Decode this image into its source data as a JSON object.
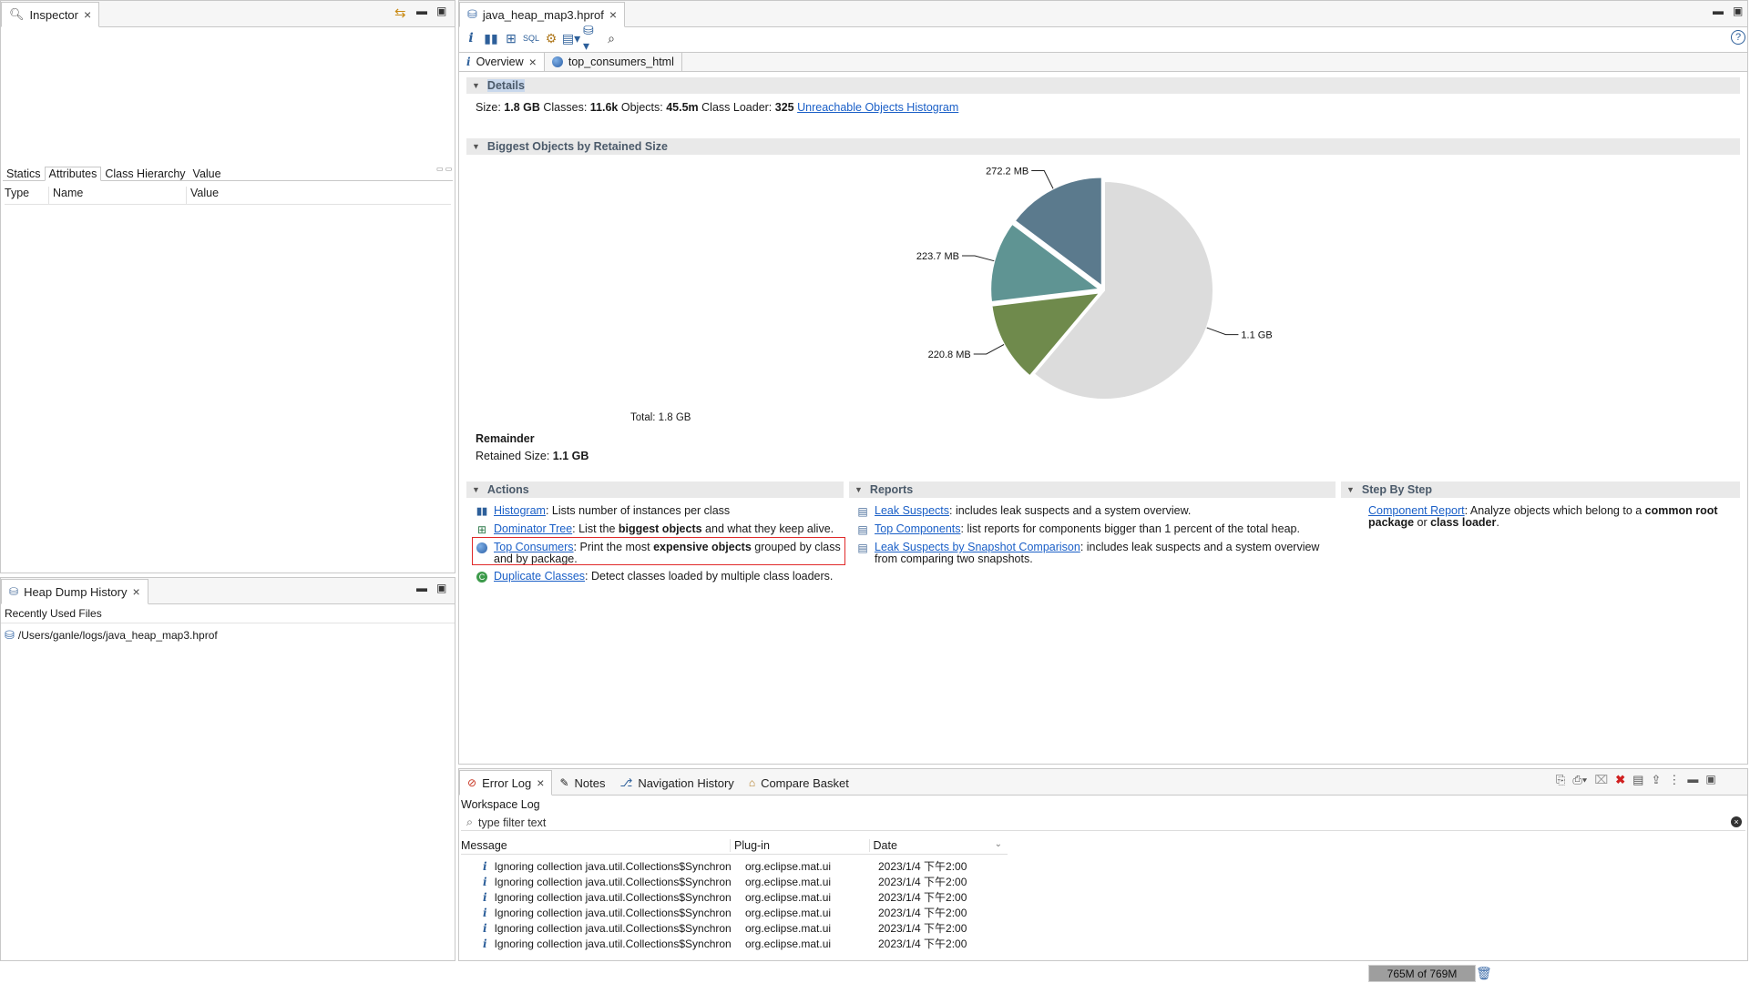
{
  "inspector": {
    "title": "Inspector",
    "tabs": [
      "Statics",
      "Attributes",
      "Class Hierarchy",
      "Value"
    ],
    "active_tab": "Attributes",
    "columns": [
      "Type",
      "Name",
      "Value"
    ]
  },
  "heap_history": {
    "title": "Heap Dump History",
    "header": "Recently Used Files",
    "files": [
      "/Users/ganle/logs/java_heap_map3.hprof"
    ]
  },
  "editor": {
    "tab_title": "java_heap_map3.hprof",
    "subtabs": [
      "Overview",
      "top_consumers_html"
    ],
    "active_subtab": "Overview"
  },
  "details": {
    "header": "Details",
    "size_label": "Size:",
    "size_value": "1.8 GB",
    "classes_label": "Classes:",
    "classes_value": "11.6k",
    "objects_label": "Objects:",
    "objects_value": "45.5m",
    "loader_label": "Class Loader:",
    "loader_value": "325",
    "histogram_link": "Unreachable Objects Histogram"
  },
  "biggest": {
    "header": "Biggest Objects by Retained Size",
    "total": "Total: 1.8 GB",
    "remainder_title": "Remainder",
    "retained_label": "Retained Size:",
    "retained_value": "1.1 GB"
  },
  "chart_data": {
    "type": "pie",
    "title": "",
    "slices": [
      {
        "label": "272.2 MB",
        "value": 272.2,
        "color": "#5b7a8d"
      },
      {
        "label": "223.7 MB",
        "value": 223.7,
        "color": "#5f9493"
      },
      {
        "label": "220.8 MB",
        "value": 220.8,
        "color": "#6f8a4c"
      },
      {
        "label": "1.1 GB",
        "value": 1126.4,
        "color": "#dcdcdc"
      }
    ]
  },
  "actions": {
    "header": "Actions",
    "items": [
      {
        "link": "Histogram",
        "pre": ": Lists number of instances per class",
        "bold": "",
        "post": "",
        "icon": "histogram-icon"
      },
      {
        "link": "Dominator Tree",
        "pre": ": List the ",
        "bold": "biggest objects",
        "post": " and what they keep alive.",
        "icon": "dominator-tree-icon"
      },
      {
        "link": "Top Consumers",
        "pre": ": Print the most ",
        "bold": "expensive objects",
        "post": " grouped by class and by package.",
        "icon": "globe-icon"
      },
      {
        "link": "Duplicate Classes",
        "pre": ": Detect classes loaded by multiple class loaders.",
        "bold": "",
        "post": "",
        "icon": "duplicate-classes-icon"
      }
    ]
  },
  "reports": {
    "header": "Reports",
    "items": [
      {
        "link": "Leak Suspects",
        "text": ": includes leak suspects and a system overview."
      },
      {
        "link": "Top Components",
        "text": ": list reports for components bigger than 1 percent of the total heap."
      },
      {
        "link": "Leak Suspects by Snapshot Comparison",
        "text": ": includes leak suspects and a system overview from comparing two snapshots."
      }
    ]
  },
  "stepbystep": {
    "header": "Step By Step",
    "link": "Component Report",
    "pre": ": Analyze objects which belong to a ",
    "bold1": "common root package",
    "mid": " or ",
    "bold2": "class loader",
    "post": "."
  },
  "errorlog": {
    "tabs": [
      "Error Log",
      "Notes",
      "Navigation History",
      "Compare Basket"
    ],
    "workspace": "Workspace Log",
    "filter_placeholder": "type filter text",
    "columns": [
      "Message",
      "Plug-in",
      "Date"
    ],
    "rows": [
      {
        "message": "Ignoring collection java.util.Collections$Synchron",
        "plugin": "org.eclipse.mat.ui",
        "date": "2023/1/4 下午2:00"
      },
      {
        "message": "Ignoring collection java.util.Collections$Synchron",
        "plugin": "org.eclipse.mat.ui",
        "date": "2023/1/4 下午2:00"
      },
      {
        "message": "Ignoring collection java.util.Collections$Synchron",
        "plugin": "org.eclipse.mat.ui",
        "date": "2023/1/4 下午2:00"
      },
      {
        "message": "Ignoring collection java.util.Collections$Synchron",
        "plugin": "org.eclipse.mat.ui",
        "date": "2023/1/4 下午2:00"
      },
      {
        "message": "Ignoring collection java.util.Collections$Synchron",
        "plugin": "org.eclipse.mat.ui",
        "date": "2023/1/4 下午2:00"
      },
      {
        "message": "Ignoring collection java.util.Collections$Synchron",
        "plugin": "org.eclipse.mat.ui",
        "date": "2023/1/4 下午2:00"
      }
    ]
  },
  "status": {
    "memory": "765M of 769M"
  }
}
